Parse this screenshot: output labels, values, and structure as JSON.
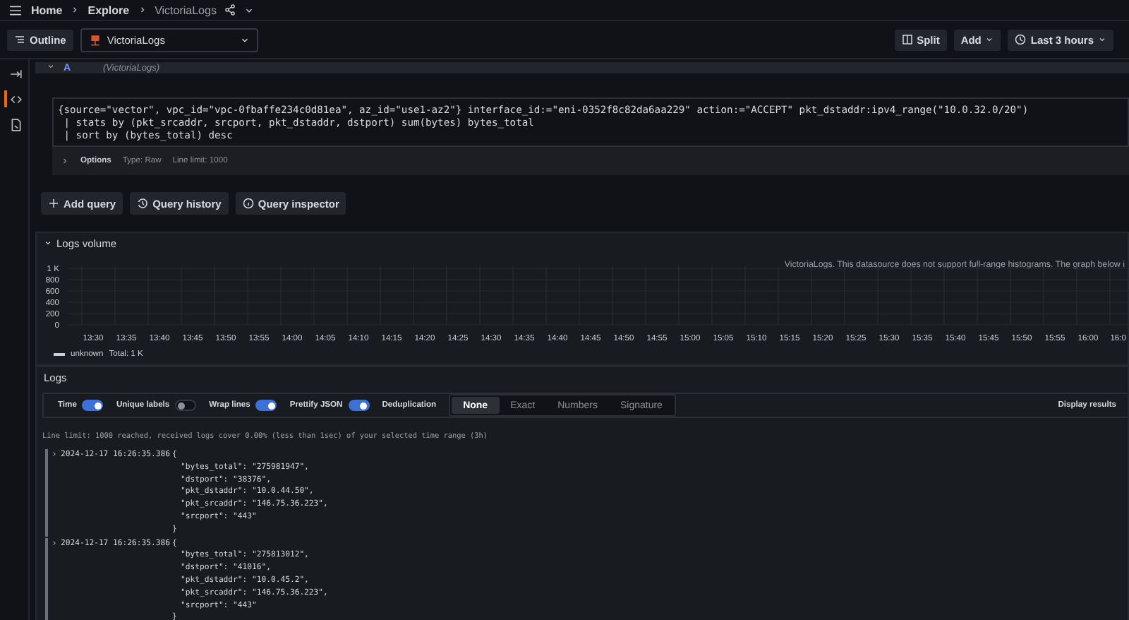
{
  "breadcrumbs": [
    "Home",
    "Explore",
    "VictoriaLogs"
  ],
  "toolbar": {
    "outline": "Outline",
    "datasource": "VictoriaLogs",
    "split": "Split",
    "add": "Add",
    "time_range": "Last 3 hours"
  },
  "rail": [
    {
      "kind": "expand",
      "selected": false
    },
    {
      "kind": "code",
      "selected": true
    },
    {
      "kind": "doc",
      "selected": false
    }
  ],
  "query": {
    "ref_id": "A",
    "datasource": "(VictoriaLogs)",
    "expanded": true,
    "lines": [
      "{source=\"vector\", vpc_id=\"vpc-0fbaffe234c0d81ea\", az_id=\"use1-az2\"} interface_id:=\"eni-0352f8c82da6aa229\" action:=\"ACCEPT\" pkt_dstaddr:ipv4_range(\"10.0.32.0/20\")",
      " | stats by (pkt_srcaddr, srcport, pkt_dstaddr, dstport) sum(bytes) bytes_total",
      " | sort by (bytes_total) desc"
    ],
    "options": {
      "label": "Options",
      "type": "Type: Raw",
      "line_limit": "Line limit: 1000"
    }
  },
  "query_buttons": [
    {
      "kind": "add",
      "label": "Add query"
    },
    {
      "kind": "history",
      "label": "Query history"
    },
    {
      "kind": "inspector",
      "label": "Query inspector"
    }
  ],
  "logs_volume": {
    "title": "Logs volume",
    "expanded": true,
    "notice": "VictoriaLogs. This datasource does not support full-range histograms. The graph below i",
    "chart_data": {
      "type": "bar",
      "grid": true,
      "ylim": [
        0,
        1000
      ],
      "yticks": [
        {
          "value": 0,
          "label": "0"
        },
        {
          "value": 200,
          "label": "200"
        },
        {
          "value": 400,
          "label": "400"
        },
        {
          "value": 600,
          "label": "600"
        },
        {
          "value": 800,
          "label": "800"
        },
        {
          "value": 1000,
          "label": "1 K"
        }
      ],
      "categories": [
        "13:30",
        "13:35",
        "13:40",
        "13:45",
        "13:50",
        "13:55",
        "14:00",
        "14:05",
        "14:10",
        "14:15",
        "14:20",
        "14:25",
        "14:30",
        "14:35",
        "14:40",
        "14:45",
        "14:50",
        "14:55",
        "15:00",
        "15:05",
        "15:10",
        "15:15",
        "15:20",
        "15:25",
        "15:30",
        "15:35",
        "15:40",
        "15:45",
        "15:50",
        "15:55",
        "16:00",
        "16:0"
      ]
    },
    "legend": {
      "name": "unknown",
      "total": "Total: 1 K"
    }
  },
  "logs": {
    "title": "Logs",
    "toggles": [
      {
        "label": "Time",
        "on": true
      },
      {
        "label": "Unique labels",
        "on": false
      },
      {
        "label": "Wrap lines",
        "on": true
      },
      {
        "label": "Prettify JSON",
        "on": true
      }
    ],
    "dedup": {
      "label": "Deduplication",
      "options": [
        {
          "label": "None",
          "selected": true
        },
        {
          "label": "Exact",
          "selected": false
        },
        {
          "label": "Numbers",
          "selected": false
        },
        {
          "label": "Signature",
          "selected": false
        }
      ]
    },
    "display_results": "Display results",
    "limit_notice": "Line limit: 1000 reached, received logs cover 0.00% (less than 1sec) of your selected time range (3h)",
    "entries": [
      {
        "timestamp": "2024-12-17 16:26:35.386",
        "open": "{",
        "close": "}",
        "fields": [
          "\"bytes_total\": \"275981947\",",
          "\"dstport\": \"38376\",",
          "\"pkt_dstaddr\": \"10.0.44.50\",",
          "\"pkt_srcaddr\": \"146.75.36.223\",",
          "\"srcport\": \"443\""
        ]
      },
      {
        "timestamp": "2024-12-17 16:26:35.386",
        "open": "{",
        "close": "}",
        "fields": [
          "\"bytes_total\": \"275813012\",",
          "\"dstport\": \"41016\",",
          "\"pkt_dstaddr\": \"10.0.45.2\",",
          "\"pkt_srcaddr\": \"146.75.36.223\",",
          "\"srcport\": \"443\""
        ]
      }
    ]
  }
}
